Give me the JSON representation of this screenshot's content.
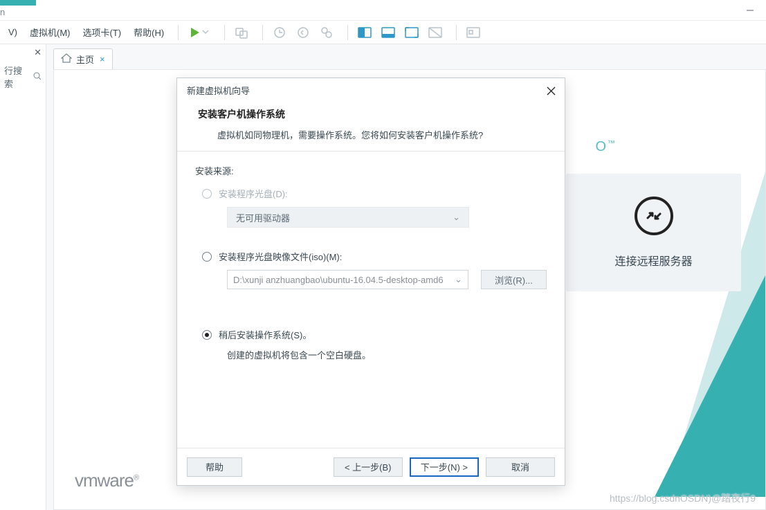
{
  "titlebar": {
    "text": "n"
  },
  "menus": {
    "view": "V)",
    "vm": "虚拟机(M)",
    "tabs": "选项卡(T)",
    "help": "帮助(H)"
  },
  "tab": {
    "home": "主页"
  },
  "sidebar": {
    "search": "行搜索"
  },
  "bg": {
    "brand_trail": "O",
    "tm": "™",
    "card_label": "连接远程服务器",
    "vmware": "vmware",
    "reg": "®"
  },
  "watermark": "https://blog.csdnOSDN)@踏夜行9",
  "dialog": {
    "title": "新建虚拟机向导",
    "heading": "安装客户机操作系统",
    "subheading": "虚拟机如同物理机，需要操作系统。您将如何安装客户机操作系统?",
    "source_label": "安装来源:",
    "opt_disc": "安装程序光盘(D):",
    "disc_dropdown": "无可用驱动器",
    "opt_iso": "安装程序光盘映像文件(iso)(M):",
    "iso_path": "D:\\xunji anzhuangbao\\ubuntu-16.04.5-desktop-amd6",
    "browse": "浏览(R)...",
    "opt_later": "稍后安装操作系统(S)。",
    "later_desc": "创建的虚拟机将包含一个空白硬盘。",
    "help": "帮助",
    "back": "< 上一步(B)",
    "next": "下一步(N) >",
    "cancel": "取消"
  }
}
